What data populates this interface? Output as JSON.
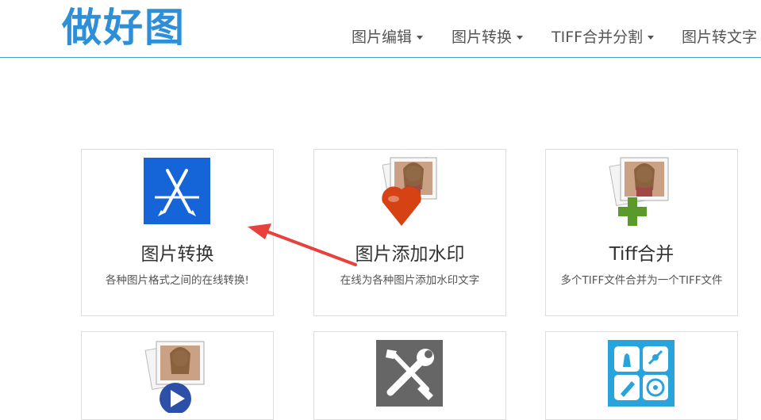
{
  "site": {
    "logo": "做好图"
  },
  "nav": [
    {
      "label": "图片编辑"
    },
    {
      "label": "图片转换"
    },
    {
      "label": "TIFF合并分割"
    },
    {
      "label": "图片转文字"
    }
  ],
  "cards": [
    {
      "title": "图片转换",
      "desc": "各种图片格式之间的在线转换!",
      "icon": "app-store-icon"
    },
    {
      "title": "图片添加水印",
      "desc": "在线为各种图片添加水印文字",
      "icon": "photo-heart-icon"
    },
    {
      "title": "Tiff合并",
      "desc": "多个TIFF文件合并为一个TIFF文件",
      "icon": "photo-plus-icon"
    },
    {
      "title": "",
      "desc": "",
      "icon": "photo-play-icon"
    },
    {
      "title": "",
      "desc": "",
      "icon": "tools-icon"
    },
    {
      "title": "",
      "desc": "",
      "icon": "apps-grid-icon"
    }
  ],
  "colors": {
    "logo": "#2d8fd8",
    "header_line": "#3aa6b9",
    "annotation_arrow": "#e8403a"
  }
}
